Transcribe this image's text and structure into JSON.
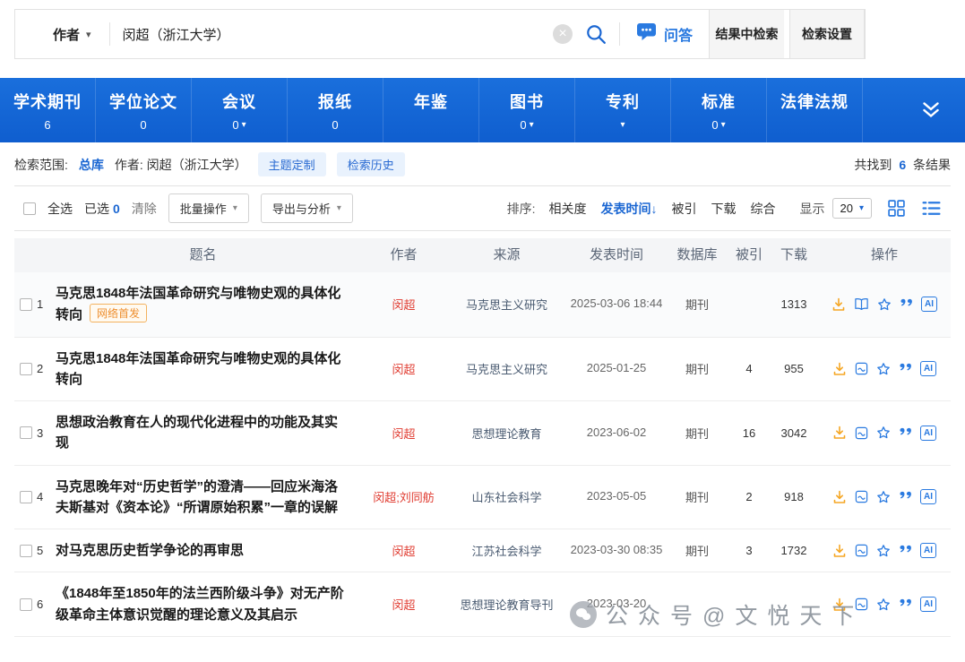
{
  "colors": {
    "accent_blue": "#1a66d2",
    "nav_blue": "#1266d5",
    "author_red": "#e03c31",
    "download_orange": "#f5a623"
  },
  "search": {
    "field_selector": "作者",
    "query": "闵超（浙江大学）",
    "qa_label": "问答",
    "search_in_results_label": "结果中检索",
    "settings_label": "检索设置"
  },
  "nav": {
    "tabs": [
      {
        "label": "学术期刊",
        "count": "6",
        "caret": false
      },
      {
        "label": "学位论文",
        "count": "0",
        "caret": false
      },
      {
        "label": "会议",
        "count": "0",
        "caret": true
      },
      {
        "label": "报纸",
        "count": "0",
        "caret": false
      },
      {
        "label": "年鉴",
        "count": "",
        "caret": false
      },
      {
        "label": "图书",
        "count": "0",
        "caret": true
      },
      {
        "label": "专利",
        "count": "",
        "caret": true
      },
      {
        "label": "标准",
        "count": "0",
        "caret": true
      },
      {
        "label": "法律法规",
        "count": "",
        "caret": false
      }
    ]
  },
  "filter": {
    "scope_label": "检索范围:",
    "scope_value": "总库",
    "condition": "作者: 闵超（浙江大学）",
    "topic_button": "主题定制",
    "history_button": "检索历史",
    "found_prefix": "共找到",
    "found_count": "6",
    "found_suffix": "条结果"
  },
  "toolbar": {
    "select_all": "全选",
    "selected_label": "已选",
    "selected_count": "0",
    "clear": "清除",
    "batch_button": "批量操作",
    "export_button": "导出与分析",
    "sort_label": "排序:",
    "sorts": [
      {
        "label": "相关度",
        "active": false,
        "arrow": ""
      },
      {
        "label": "发表时间",
        "active": true,
        "arrow": "↓"
      },
      {
        "label": "被引",
        "active": false,
        "arrow": ""
      },
      {
        "label": "下载",
        "active": false,
        "arrow": ""
      },
      {
        "label": "综合",
        "active": false,
        "arrow": ""
      }
    ],
    "display_label": "显示",
    "page_size": "20"
  },
  "table": {
    "headers": [
      "题名",
      "作者",
      "来源",
      "发表时间",
      "数据库",
      "被引",
      "下载",
      "操作"
    ],
    "ai_label": "AI",
    "rows": [
      {
        "num": "1",
        "title": "马克思1848年法国革命研究与唯物史观的具体化转向",
        "badge": "网络首发",
        "authors": "闵超",
        "source": "马克思主义研究",
        "date": "2025-03-06 18:44",
        "database": "期刊",
        "cited": "",
        "downloads": "1313",
        "ops": [
          "download",
          "book",
          "star",
          "quote",
          "ai"
        ]
      },
      {
        "num": "2",
        "title": "马克思1848年法国革命研究与唯物史观的具体化转向",
        "badge": "",
        "authors": "闵超",
        "source": "马克思主义研究",
        "date": "2025-01-25",
        "database": "期刊",
        "cited": "4",
        "downloads": "955",
        "ops": [
          "download",
          "html",
          "star",
          "quote",
          "ai"
        ]
      },
      {
        "num": "3",
        "title": "思想政治教育在人的现代化进程中的功能及其实现",
        "badge": "",
        "authors": "闵超",
        "source": "思想理论教育",
        "date": "2023-06-02",
        "database": "期刊",
        "cited": "16",
        "downloads": "3042",
        "ops": [
          "download",
          "html",
          "star",
          "quote",
          "ai"
        ]
      },
      {
        "num": "4",
        "title": "马克思晚年对“历史哲学”的澄清——回应米海洛夫斯基对《资本论》“所谓原始积累”一章的误解",
        "badge": "",
        "authors": "闵超;刘同舫",
        "source": "山东社会科学",
        "date": "2023-05-05",
        "database": "期刊",
        "cited": "2",
        "downloads": "918",
        "ops": [
          "download",
          "html",
          "star",
          "quote",
          "ai"
        ]
      },
      {
        "num": "5",
        "title": "对马克思历史哲学争论的再审思",
        "badge": "",
        "authors": "闵超",
        "source": "江苏社会科学",
        "date": "2023-03-30 08:35",
        "database": "期刊",
        "cited": "3",
        "downloads": "1732",
        "ops": [
          "download",
          "html",
          "star",
          "quote",
          "ai"
        ]
      },
      {
        "num": "6",
        "title": "《1848年至1850年的法兰西阶级斗争》对无产阶级革命主体意识觉醒的理论意义及其启示",
        "badge": "",
        "authors": "闵超",
        "source": "思想理论教育导刊",
        "date": "2023-03-20",
        "database": "",
        "cited": "",
        "downloads": "",
        "ops": [
          "download",
          "html",
          "star",
          "quote",
          "ai"
        ]
      }
    ]
  },
  "watermark": "公众号@文悦天下"
}
